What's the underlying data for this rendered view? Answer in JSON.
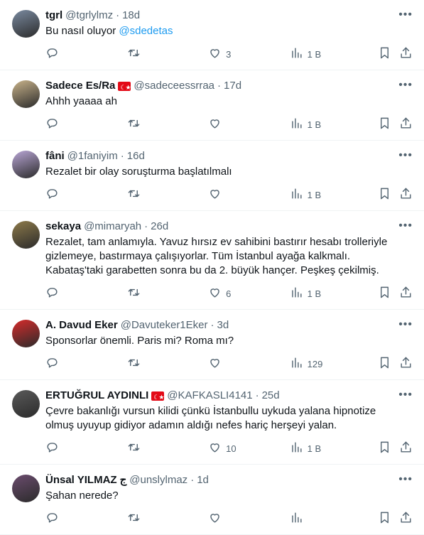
{
  "tweets": [
    {
      "name": "tgrl",
      "handle": "@tgrlylmz",
      "time": "18d",
      "text": "Bu nasıl oluyor ",
      "mention": "@sdedetas",
      "replies": "",
      "retweets": "",
      "likes": "3",
      "views": "1 B",
      "flag": false,
      "avatar_color": "#7a8aa0"
    },
    {
      "name": "Sadece Es/Ra",
      "handle": "@sadeceessrraa",
      "time": "17d",
      "text": "Ahhh yaaaa ah",
      "mention": "",
      "replies": "",
      "retweets": "",
      "likes": "",
      "views": "1 B",
      "flag": true,
      "avatar_color": "#c9b38a"
    },
    {
      "name": "fâni",
      "handle": "@1faniyim",
      "time": "16d",
      "text": "Rezalet bir olay soruşturma başlatılmalı",
      "mention": "",
      "replies": "",
      "retweets": "",
      "likes": "",
      "views": "1 B",
      "flag": false,
      "avatar_color": "#b9a6d6"
    },
    {
      "name": "sekaya",
      "handle": "@mimaryah",
      "time": "26d",
      "text": "Rezalet, tam anlamıyla. Yavuz hırsız ev sahibini bastırır hesabı trolleriyle gizlemeye, bastırmaya çalışıyorlar. Tüm İstanbul ayağa kalkmalı. Kabataş'taki garabetten sonra bu da 2. büyük hançer. Peşkeş çekilmiş.",
      "mention": "",
      "replies": "",
      "retweets": "",
      "likes": "6",
      "views": "1 B",
      "flag": false,
      "avatar_color": "#8d7a4a"
    },
    {
      "name": "A. Davud Eker",
      "handle": "@Davuteker1Eker",
      "time": "3d",
      "text": "Sponsorlar önemli. Paris mi? Roma mı?",
      "mention": "",
      "replies": "",
      "retweets": "",
      "likes": "",
      "views": "129",
      "flag": false,
      "avatar_color": "#d62b2b"
    },
    {
      "name": "ERTUĞRUL AYDINLI",
      "handle": "@KAFKASLI4141",
      "time": "25d",
      "text": "Çevre bakanlığı vursun kilidi çünkü İstanbullu uykuda yalana hipnotize olmuş uyuyup gidiyor adamın aldığı nefes hariç herşeyi yalan.",
      "mention": "",
      "replies": "",
      "retweets": "",
      "likes": "10",
      "views": "1 B",
      "flag": true,
      "avatar_color": "#5a5a5a"
    },
    {
      "name": "Ünsal YILMAZ",
      "name_suffix": "ج",
      "handle": "@unslylmaz",
      "time": "1d",
      "text": "Şahan nerede?",
      "mention": "",
      "replies": "",
      "retweets": "",
      "likes": "",
      "views": "",
      "flag": false,
      "avatar_color": "#6b4c6e"
    }
  ],
  "more_label": "•••"
}
